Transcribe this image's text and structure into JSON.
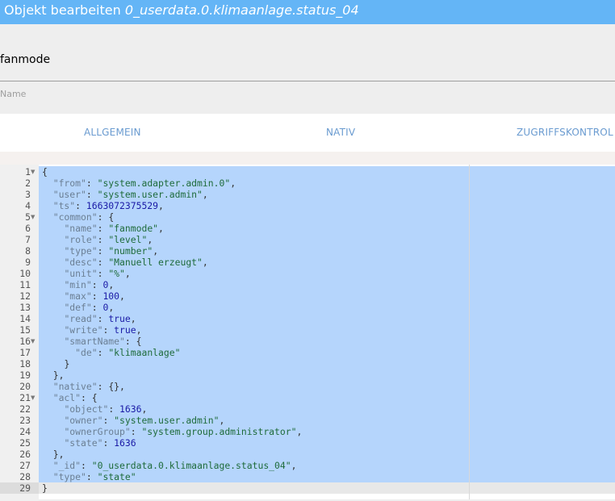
{
  "title": {
    "prefix": "Objekt bearbeiten ",
    "object_id": "0_userdata.0.klimaanlage.status_04"
  },
  "name_field": {
    "value": "fanmode",
    "label": "Name"
  },
  "tabs": [
    {
      "label": "ALLGEMEIN"
    },
    {
      "label": "NATIV"
    },
    {
      "label": "ZUGRIFFSKONTROL"
    }
  ],
  "editor": {
    "active_line": 29,
    "fold_lines": [
      1,
      5,
      16,
      21
    ],
    "lines": [
      "{",
      "  \"from\": \"system.adapter.admin.0\",",
      "  \"user\": \"system.user.admin\",",
      "  \"ts\": 1663072375529,",
      "  \"common\": {",
      "    \"name\": \"fanmode\",",
      "    \"role\": \"level\",",
      "    \"type\": \"number\",",
      "    \"desc\": \"Manuell erzeugt\",",
      "    \"unit\": \"%\",",
      "    \"min\": 0,",
      "    \"max\": 100,",
      "    \"def\": 0,",
      "    \"read\": true,",
      "    \"write\": true,",
      "    \"smartName\": {",
      "      \"de\": \"klimaanlage\"",
      "    }",
      "  },",
      "  \"native\": {},",
      "  \"acl\": {",
      "    \"object\": 1636,",
      "    \"owner\": \"system.user.admin\",",
      "    \"ownerGroup\": \"system.group.administrator\",",
      "    \"state\": 1636",
      "  },",
      "  \"_id\": \"0_userdata.0.klimaanlage.status_04\",",
      "  \"type\": \"state\"",
      "}"
    ]
  }
}
